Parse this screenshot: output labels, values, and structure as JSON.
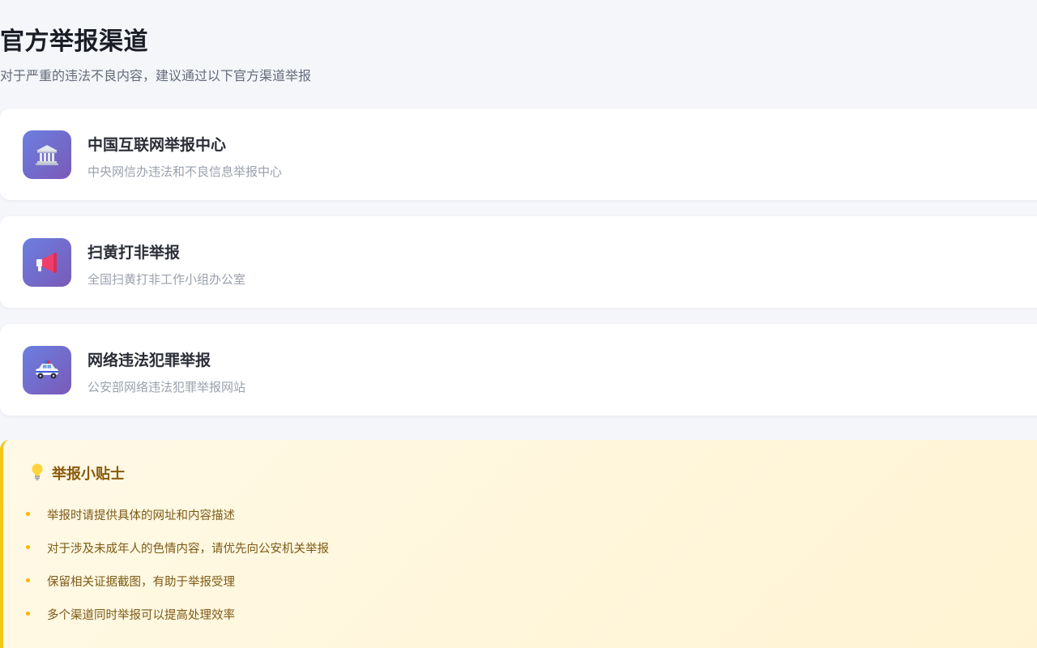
{
  "header": {
    "title": "官方举报渠道",
    "subtitle": "对于严重的违法不良内容，建议通过以下官方渠道举报"
  },
  "channels": [
    {
      "icon": "government-building-icon",
      "title": "中国互联网举报中心",
      "description": "中央网信办违法和不良信息举报中心"
    },
    {
      "icon": "megaphone-icon",
      "title": "扫黄打非举报",
      "description": "全国扫黄打非工作小组办公室"
    },
    {
      "icon": "police-car-icon",
      "title": "网络违法犯罪举报",
      "description": "公安部网络违法犯罪举报网站"
    }
  ],
  "tips": {
    "icon": "lightbulb-icon",
    "title": "举报小贴士",
    "items": [
      "举报时请提供具体的网址和内容描述",
      "对于涉及未成年人的色情内容，请优先向公安机关举报",
      "保留相关证据截图，有助于举报受理",
      "多个渠道同时举报可以提高处理效率"
    ]
  },
  "colors": {
    "icon_gradient_start": "#6b7fe0",
    "icon_gradient_end": "#7a5ab8",
    "tips_accent": "#f5c518",
    "tips_title": "#8a5a0b"
  }
}
